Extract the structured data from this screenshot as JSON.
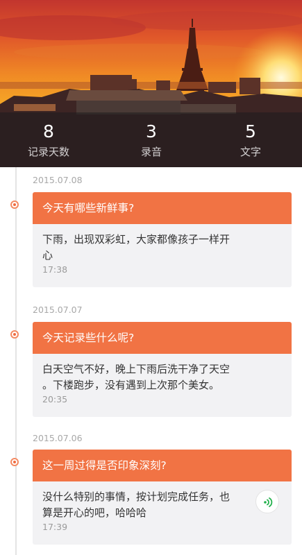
{
  "stats": [
    {
      "value": "8",
      "label": "记录天数"
    },
    {
      "value": "3",
      "label": "录音"
    },
    {
      "value": "5",
      "label": "文字"
    }
  ],
  "entries": [
    {
      "date": "2015.07.08",
      "question": "今天有哪些新鲜事?",
      "content_line1": "下雨，出现双彩虹，大家都像孩子一样开",
      "content_line2": "心",
      "time": "17:38"
    },
    {
      "date": "2015.07.07",
      "question": "今天记录些什么呢?",
      "content_line1": "白天空气不好，晚上下雨后洗干净了天空",
      "content_line2": "。下楼跑步，没有遇到上次那个美女。",
      "time": "20:35"
    },
    {
      "date": "2015.07.06",
      "question": "这一周过得是否印象深刻?",
      "content_line1": "没什么特别的事情，按计划完成任务，也",
      "content_line2": "算是开心的吧，哈哈哈",
      "time": "17:39",
      "icon": "voice-play-icon"
    }
  ],
  "colors": {
    "accent": "#f17344",
    "card_bg": "#f2f2f4",
    "voice_icon": "#22b14c"
  }
}
